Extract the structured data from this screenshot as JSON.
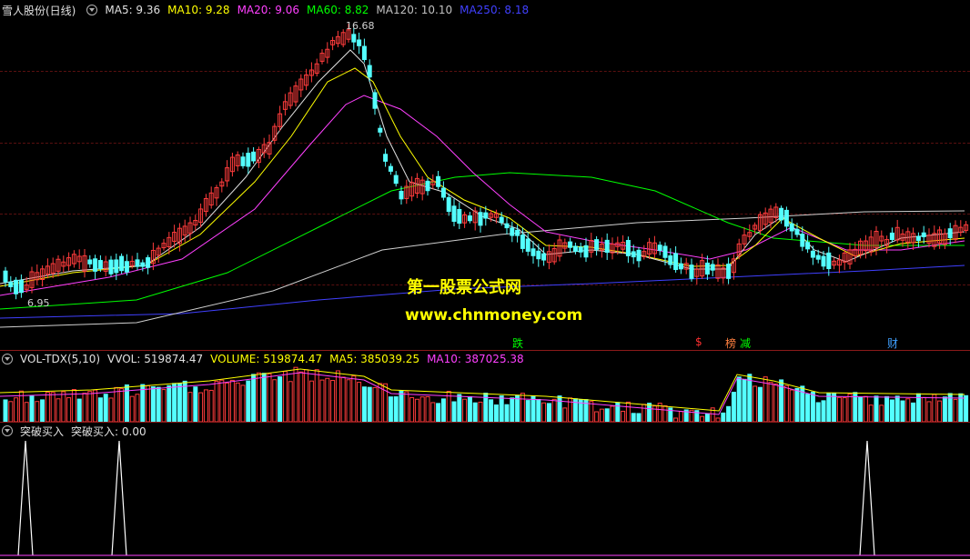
{
  "main": {
    "stock_name": "雪人股份(日线)",
    "ma_labels": [
      {
        "text": "MA5: 9.36",
        "color": "#e0e0e0"
      },
      {
        "text": "MA10: 9.28",
        "color": "#ffff00"
      },
      {
        "text": "MA20: 9.06",
        "color": "#ff40ff"
      },
      {
        "text": "MA60: 8.82",
        "color": "#00ff00"
      },
      {
        "text": "MA120: 10.10",
        "color": "#c0c0c0"
      },
      {
        "text": "MA250: 8.18",
        "color": "#4040ff"
      }
    ],
    "high_label": "16.68",
    "low_label": "6.95",
    "events": [
      {
        "text": "跌",
        "color": "#00ff00"
      },
      {
        "text": "$",
        "color": "#ff3030"
      },
      {
        "text": "榜",
        "color": "#ff8040"
      },
      {
        "text": "减",
        "color": "#00ff00"
      },
      {
        "text": "财",
        "color": "#40a0ff"
      }
    ],
    "watermark_title": "第一股票公式网",
    "watermark_url": "www.chnmoney.com"
  },
  "volume": {
    "indicator": "VOL-TDX(5,10)",
    "labels": [
      {
        "text": "VVOL: 519874.47",
        "color": "#e0e0e0"
      },
      {
        "text": "VOLUME: 519874.47",
        "color": "#ffff00"
      },
      {
        "text": "MA5: 385039.25",
        "color": "#ffff00"
      },
      {
        "text": "MA10: 387025.38",
        "color": "#ff40ff"
      }
    ]
  },
  "signal": {
    "indicator": "突破买入",
    "value_label": "突破买入: 0.00"
  },
  "colors": {
    "up": "#ff3c3c",
    "down": "#54ffff",
    "background": "#000000",
    "separator": "#8b1a1a"
  }
}
